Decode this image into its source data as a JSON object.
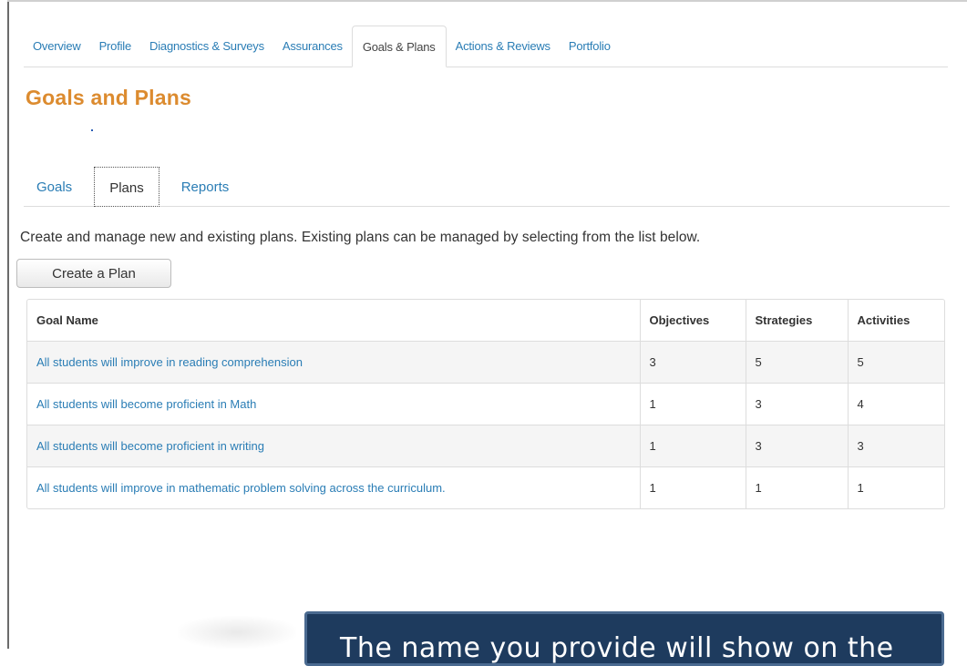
{
  "main_tabs": [
    {
      "label": "Overview"
    },
    {
      "label": "Profile"
    },
    {
      "label": "Diagnostics & Surveys"
    },
    {
      "label": "Assurances"
    },
    {
      "label": "Goals & Plans"
    },
    {
      "label": "Actions & Reviews"
    },
    {
      "label": "Portfolio"
    }
  ],
  "main_tabs_active": "Goals & Plans",
  "page_title": "Goals and Plans",
  "sub_tabs": [
    {
      "label": "Goals"
    },
    {
      "label": "Plans"
    },
    {
      "label": "Reports"
    }
  ],
  "sub_tabs_active": "Plans",
  "description": "Create and manage new and existing plans. Existing plans can be managed by selecting from the list below.",
  "create_button": "Create a Plan",
  "table": {
    "headers": [
      "Goal Name",
      "Objectives",
      "Strategies",
      "Activities"
    ],
    "rows": [
      {
        "goal": "All students will improve in reading comprehension",
        "objectives": "3",
        "strategies": "5",
        "activities": "5"
      },
      {
        "goal": "All students will become proficient in Math",
        "objectives": "1",
        "strategies": "3",
        "activities": "4"
      },
      {
        "goal": "All students will become proficient in writing",
        "objectives": "1",
        "strategies": "3",
        "activities": "3"
      },
      {
        "goal": "All students will improve in mathematic problem solving across the curriculum.",
        "objectives": "1",
        "strategies": "1",
        "activities": "1"
      }
    ]
  },
  "callout_text": "The name you provide will show on the",
  "colors": {
    "link": "#2a7db5",
    "title": "#dc8b2f",
    "callout_bg": "#1e3b5e"
  }
}
